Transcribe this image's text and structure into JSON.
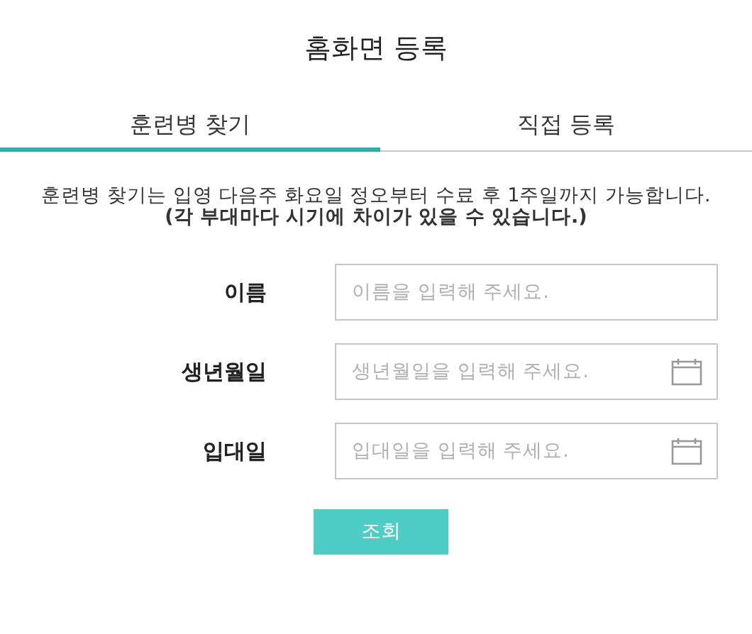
{
  "title": "홈화면 등록",
  "tabs": [
    {
      "label": "훈련병 찾기",
      "selected": true
    },
    {
      "label": "직접 등록",
      "selected": false
    }
  ],
  "notice": [
    "훈련병 찾기는 입영 다음주 화요일 정오부터 수료 후 1주일까지 가능합니다.",
    "(각 부대마다 시기에 차이가 있을 수 있습니다.)"
  ],
  "fields": [
    {
      "label": "이름",
      "placeholder": "이름을 입력해 주세요.",
      "kind": "text"
    },
    {
      "label": "생년월일",
      "placeholder": "생년월일을 입력해 주세요.",
      "kind": "date"
    },
    {
      "label": "입대일",
      "placeholder": "입대일을 입력해 주세요.",
      "kind": "date"
    }
  ],
  "button": "조회"
}
